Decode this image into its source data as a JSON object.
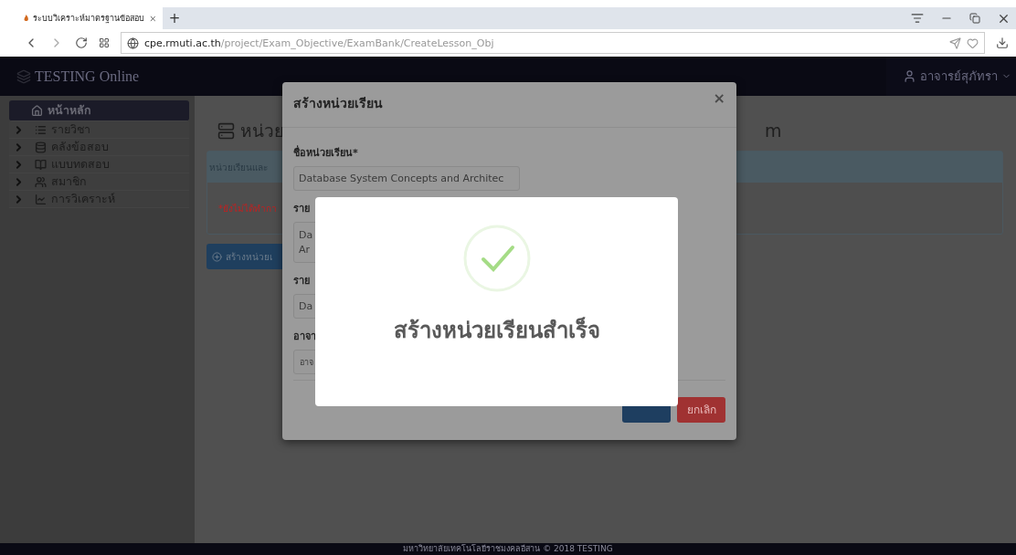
{
  "browser": {
    "tab_title": "ระบบวิเคราะห์มาตรฐานข้อสอบ",
    "new_tab": "+",
    "url_host": "cpe.rmuti.ac.th",
    "url_path": "/project/Exam_Objective/ExamBank/CreateLesson_Obj"
  },
  "navbar": {
    "brand": "TESTING Online",
    "user": "อาจารย์สุภัทรา"
  },
  "sidebar": {
    "items": [
      {
        "label": "หน้าหลัก",
        "selected": true
      },
      {
        "label": "รายวิชา",
        "selected": false
      },
      {
        "label": "คลังข้อสอบ",
        "selected": false
      },
      {
        "label": "แบบทดสอบ",
        "selected": false
      },
      {
        "label": "สมาชิก",
        "selected": false
      },
      {
        "label": "การวิเคราะห์",
        "selected": false
      }
    ]
  },
  "main": {
    "heading_parts": [
      "หน่วย",
      "m"
    ],
    "panel_header": "หน่วยเรียนและ",
    "panel_note": "*ยังไม่ได้ทำกา",
    "create_button": "สร้างหน่วยเ"
  },
  "modal": {
    "title": "สร้างหน่วยเรียน",
    "close": "×",
    "fields": [
      {
        "kind": "input",
        "label": "ชื่อหน่วยเรียน*",
        "value": "Database System Concepts and Architec"
      },
      {
        "kind": "textarea",
        "label": "ราย",
        "lines": [
          "Da",
          "Ar"
        ]
      },
      {
        "kind": "input",
        "label": "ราย",
        "value": "Da"
      },
      {
        "kind": "select",
        "label": "อาจา",
        "value": "อาจ"
      }
    ],
    "buttons": [
      {
        "kind": "primary"
      },
      {
        "label": "ยกเลิก",
        "kind": "danger"
      }
    ]
  },
  "alert": {
    "message": "สร้างหน่วยเรียนสำเร็จ"
  },
  "footer": "มหาวิทยาลัยเทคโนโลยีราชมงคลอีสาน © 2018 TESTING"
}
